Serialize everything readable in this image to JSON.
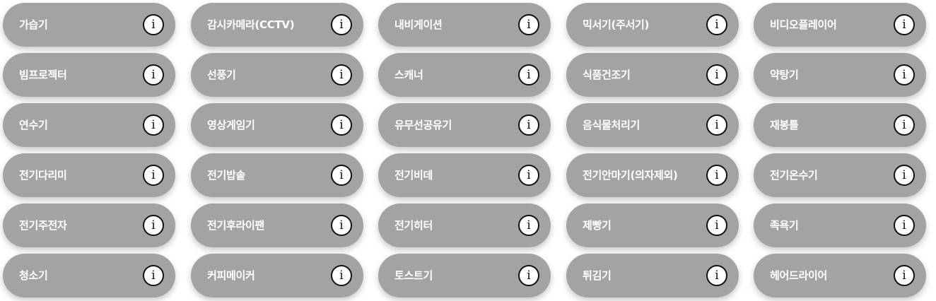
{
  "info_glyph": "i",
  "icon": "info-circle-icon",
  "colors": {
    "pill_background": "#a3a3a3",
    "pill_text": "#ffffff",
    "info_icon_border": "#111111",
    "info_icon_fill": "#ffffff"
  },
  "categories": [
    "가습기",
    "감시카메라(CCTV)",
    "내비게이션",
    "믹서기(주서기)",
    "비디오플레이어",
    "빔프로젝터",
    "선풍기",
    "스캐너",
    "식품건조기",
    "약탕기",
    "연수기",
    "영상게임기",
    "유무선공유기",
    "음식물처리기",
    "재봉틀",
    "전기다리미",
    "전기밥솥",
    "전기비데",
    "전기안마기(의자제외)",
    "전기온수기",
    "전기주전자",
    "전기후라이팬",
    "전기히터",
    "제빵기",
    "족욕기",
    "청소기",
    "커피메이커",
    "토스트기",
    "튀김기",
    "헤어드라이어"
  ]
}
